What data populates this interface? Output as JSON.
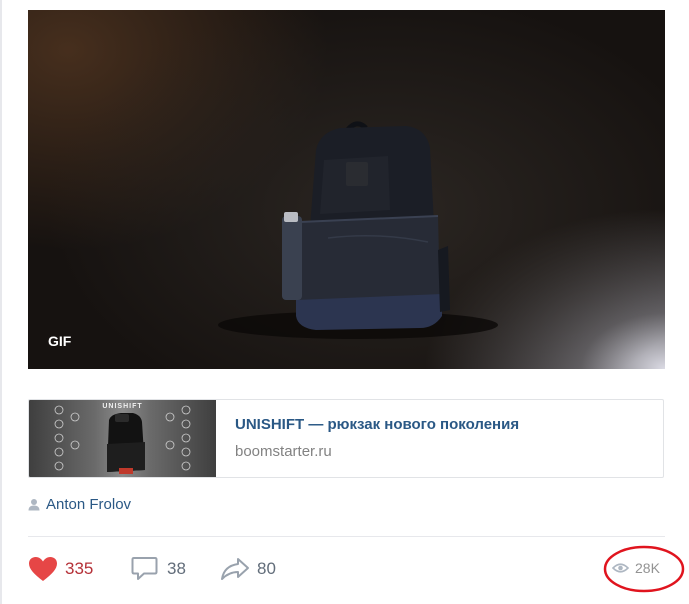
{
  "post": {
    "media": {
      "badge": "GIF",
      "description_icon": "backpack-photo"
    },
    "link": {
      "thumb_brand": "UNISHIFT",
      "title": "UNISHIFT — рюкзак нового поколения",
      "domain": "boomstarter.ru"
    },
    "author": {
      "name": "Anton Frolov",
      "icon": "user-icon"
    },
    "actions": {
      "likes": "335",
      "comments": "38",
      "shares": "80",
      "views": "28K"
    },
    "colors": {
      "like_red": "#e64646",
      "link_blue": "#2a5885",
      "icon_gray": "#99a2ad",
      "annotation_red": "#e0141e"
    }
  }
}
